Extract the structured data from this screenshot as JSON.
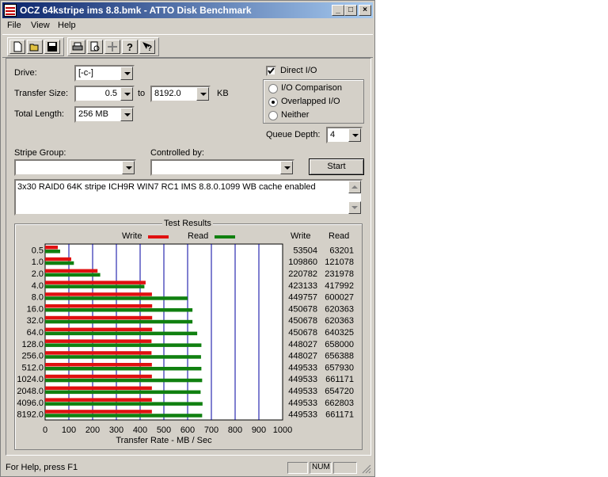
{
  "window": {
    "title": "OCZ 64kstripe ims 8.8.bmk - ATTO Disk Benchmark"
  },
  "menu": [
    {
      "label": "File"
    },
    {
      "label": "View"
    },
    {
      "label": "Help"
    }
  ],
  "toolbar": [
    "new-icon",
    "open-icon",
    "save-icon",
    "print-icon",
    "print-preview-icon",
    "move-icon",
    "help-icon",
    "context-help-icon"
  ],
  "form": {
    "drive_label": "Drive:",
    "drive_value": "[-c-]",
    "transfer_size_label": "Transfer Size:",
    "transfer_from": "0.5",
    "to_label": "to",
    "transfer_to": "8192.0",
    "kb_label": "KB",
    "total_length_label": "Total Length:",
    "total_length_value": "256 MB",
    "direct_io_label": "Direct I/O",
    "direct_io_checked": true,
    "io_options": [
      {
        "label": "I/O Comparison",
        "selected": false
      },
      {
        "label": "Overlapped I/O",
        "selected": true
      },
      {
        "label": "Neither",
        "selected": false
      }
    ],
    "queue_depth_label": "Queue Depth:",
    "queue_depth_value": "4",
    "stripe_group_label": "Stripe Group:",
    "stripe_group_value": "",
    "controlled_by_label": "Controlled by:",
    "controlled_by_value": "",
    "start_label": "Start",
    "description": "3x30 RAID0 64K stripe ICH9R WIN7 RC1 IMS 8.8.0.1099 WB cache enabled"
  },
  "results": {
    "title": "Test Results",
    "write_legend": "Write",
    "read_legend": "Read",
    "write_color": "#e01010",
    "read_color": "#108010",
    "col_write": "Write",
    "col_read": "Read",
    "xlabel": "Transfer Rate - MB / Sec"
  },
  "chart_data": {
    "type": "bar",
    "orientation": "horizontal",
    "categories": [
      "0.5",
      "1.0",
      "2.0",
      "4.0",
      "8.0",
      "16.0",
      "32.0",
      "64.0",
      "128.0",
      "256.0",
      "512.0",
      "1024.0",
      "2048.0",
      "4096.0",
      "8192.0"
    ],
    "series": [
      {
        "name": "Write",
        "values": [
          53504,
          109860,
          220782,
          423133,
          449757,
          450678,
          450678,
          450678,
          448027,
          448027,
          449533,
          449533,
          449533,
          449533,
          449533
        ]
      },
      {
        "name": "Read",
        "values": [
          63201,
          121078,
          231978,
          417992,
          600027,
          620363,
          620363,
          640325,
          658000,
          656388,
          657930,
          661171,
          654720,
          662803,
          661171
        ]
      }
    ],
    "x_ticks": [
      "0",
      "100",
      "200",
      "300",
      "400",
      "500",
      "600",
      "700",
      "800",
      "900",
      "1000"
    ],
    "xlim": [
      0,
      1000
    ],
    "xlabel": "Transfer Rate - MB / Sec",
    "grid": true,
    "legend": "top"
  },
  "statusbar": {
    "help_text": "For Help, press F1",
    "num_label": "NUM"
  }
}
